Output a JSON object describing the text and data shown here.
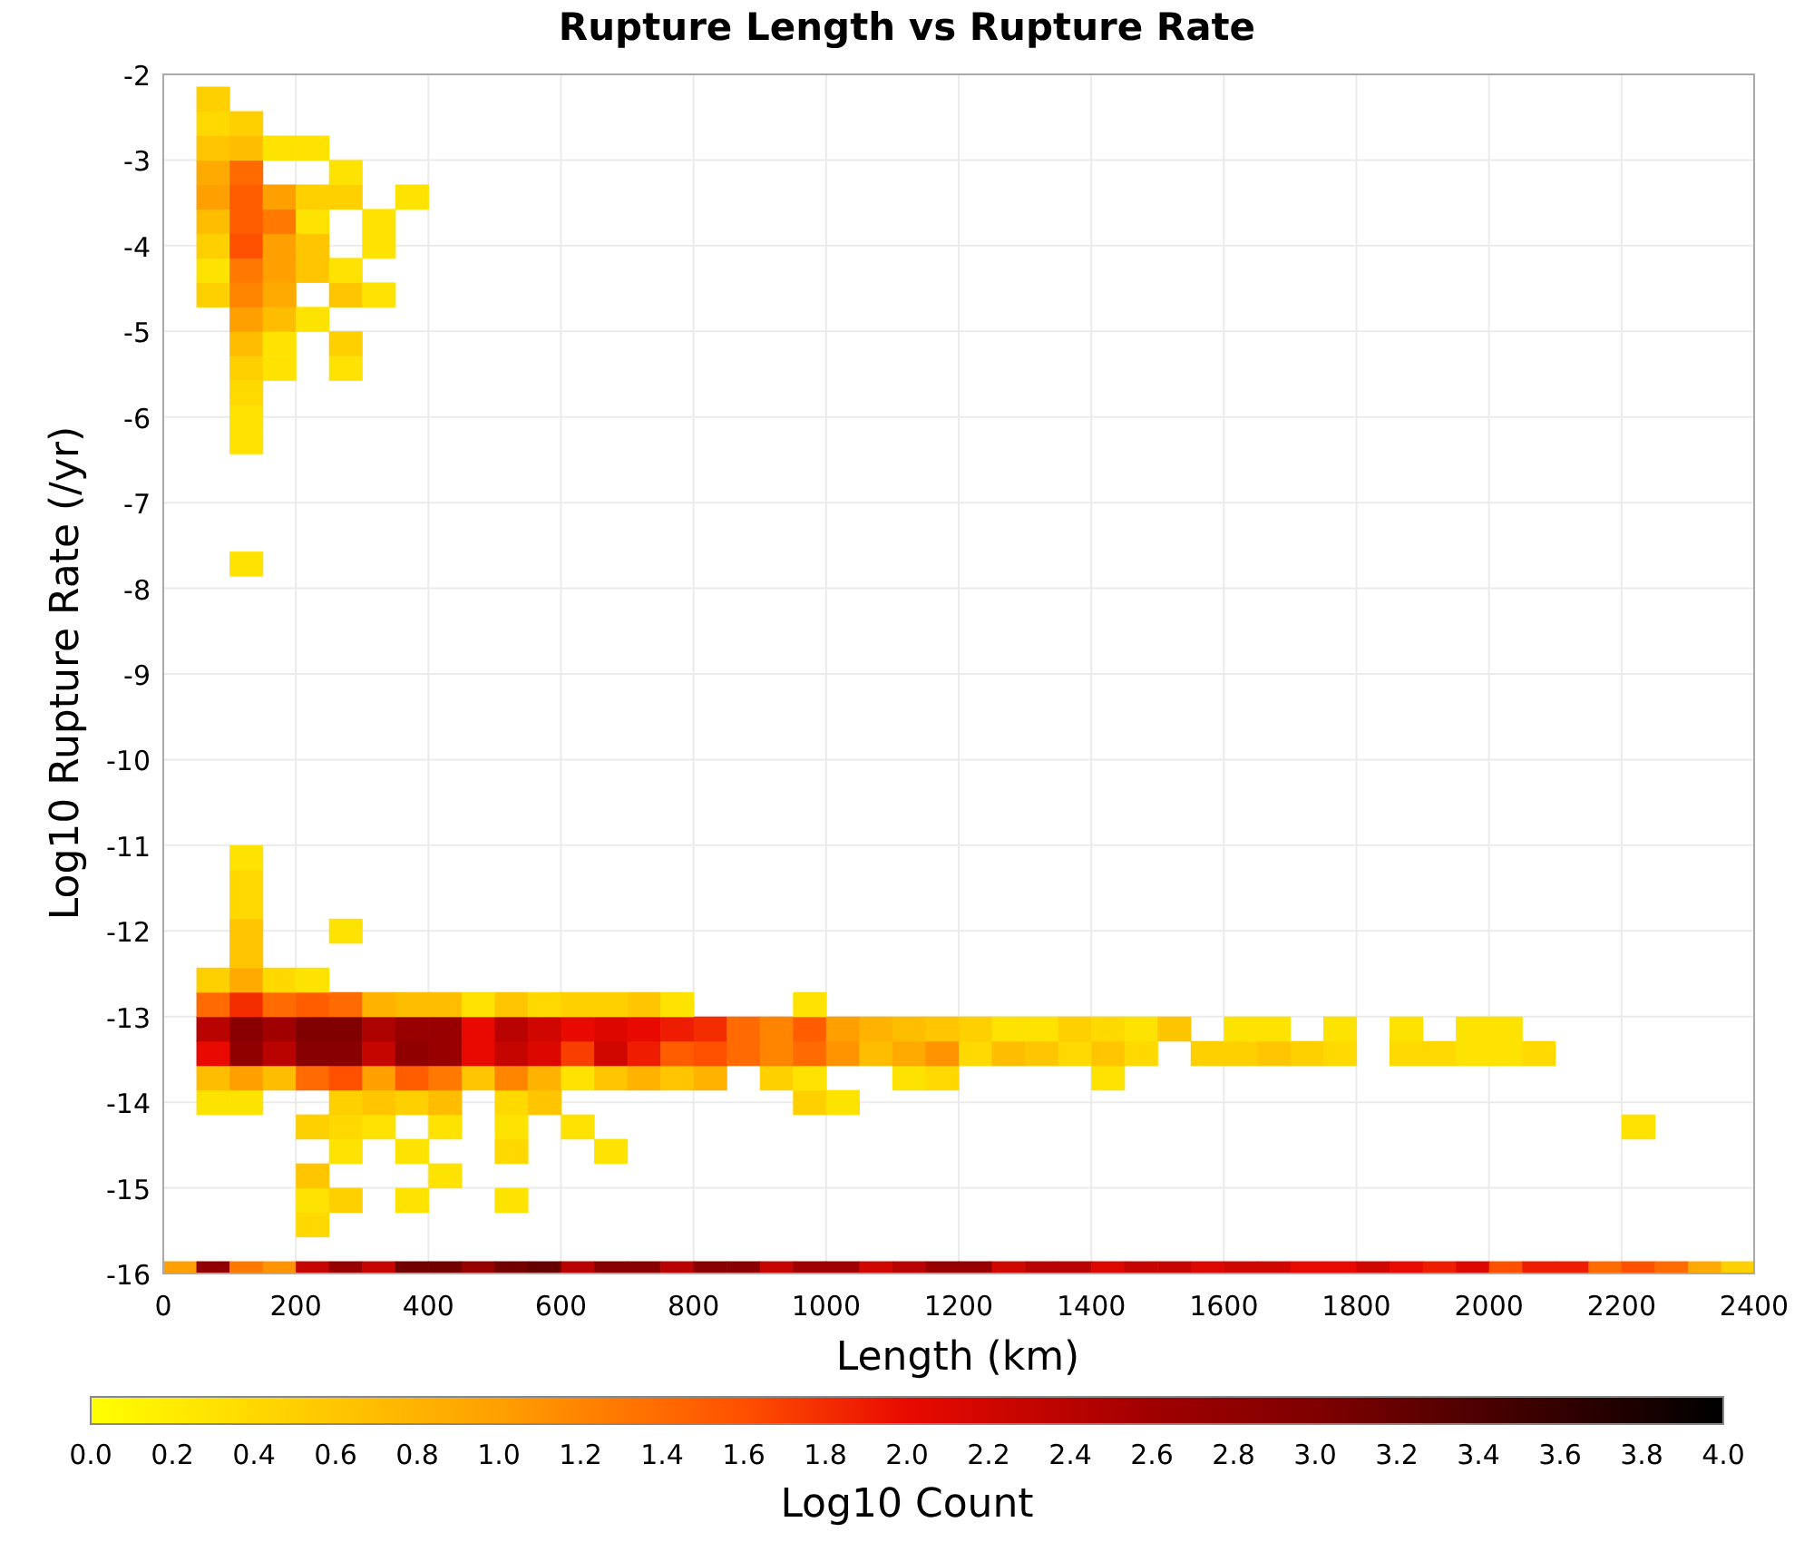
{
  "plot": {
    "title": "Rupture Length vs Rupture Rate",
    "y_axis_label": "Log10 Rupture Rate (/yr)",
    "y_ticks": [
      "-2",
      "-3",
      "-4",
      "-5",
      "-6",
      "-7",
      "-8",
      "-9",
      "-10",
      "-11",
      "-12",
      "-13",
      "-14",
      "-15",
      "-16"
    ],
    "x_axis_label": "Length (km)",
    "x_ticks": [
      "0",
      "200",
      "400",
      "600",
      "800",
      "1000",
      "1200",
      "1400",
      "1600",
      "1800",
      "2000",
      "2200",
      "2400"
    ]
  },
  "color_scale": {
    "label": "Log10 Count",
    "ticks": [
      "0.0",
      "0.2",
      "0.4",
      "0.6",
      "0.8",
      "1.0",
      "1.2",
      "1.4",
      "1.6",
      "1.8",
      "2.0",
      "2.2",
      "2.4",
      "2.6",
      "2.8",
      "3.0",
      "3.2",
      "3.4",
      "3.6",
      "3.8",
      "4.0"
    ]
  }
}
